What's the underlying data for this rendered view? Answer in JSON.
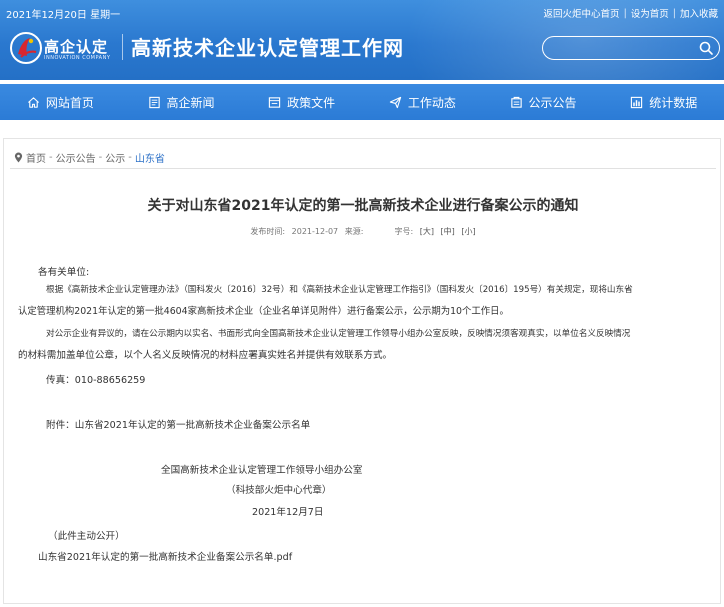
{
  "header": {
    "date": "2021年12月20日 星期一",
    "top_links": [
      "返回火炬中心首页",
      "设为首页",
      "加入收藏"
    ],
    "logo_cn": "高企认定",
    "logo_en": "INNOVATION COMPANY",
    "site_title": "高新技术企业认定管理工作网",
    "search_placeholder": ""
  },
  "nav": {
    "items": [
      {
        "label": "网站首页",
        "icon": "home-icon"
      },
      {
        "label": "高企新闻",
        "icon": "news-icon"
      },
      {
        "label": "政策文件",
        "icon": "document-icon"
      },
      {
        "label": "工作动态",
        "icon": "send-icon"
      },
      {
        "label": "公示公告",
        "icon": "announcement-icon"
      },
      {
        "label": "统计数据",
        "icon": "chart-icon"
      }
    ]
  },
  "breadcrumb": {
    "items": [
      "首页",
      "公示公告",
      "公示",
      "山东省"
    ],
    "separator": "-"
  },
  "article": {
    "title": "关于对山东省2021年认定的第一批高新技术企业进行备案公示的通知",
    "meta": {
      "publish_label": "发布时间:",
      "publish_date": "2021-12-07",
      "source_label": "来源:",
      "font_label": "字号:",
      "font_options": [
        "[大]",
        "[中]",
        "[小]"
      ]
    },
    "lines": [
      "各有关单位:",
      "根据《高新技术企业认定管理办法》（国科发火〔2016〕32号）和《高新技术企业认定管理工作指引》（国科发火〔2016〕195号）有关规定，现将山东省",
      "认定管理机构2021年认定的第一批4604家高新技术企业（企业名单详见附件）进行备案公示，公示期为10个工作日。",
      "对公示企业有异议的，请在公示期内以实名、书面形式向全国高新技术企业认定管理工作领导小组办公室反映，反映情况须客观真实，以单位名义反映情况",
      "的材料需加盖单位公章，以个人名义反映情况的材料应署真实姓名并提供有效联系方式。",
      "传真：010-88656259",
      "附件：山东省2021年认定的第一批高新技术企业备案公示名单",
      "全国高新技术企业认定管理工作领导小组办公室",
      "（科技部火炬中心代章）",
      "2021年12月7日",
      "（此件主动公开）",
      "山东省2021年认定的第一批高新技术企业备案公示名单.pdf"
    ]
  },
  "colors": {
    "header_blue": "#2a78cf",
    "nav_blue": "#2b7bd6",
    "breadcrumb_current": "#2a6fc7",
    "logo_red": "#d8262e"
  }
}
